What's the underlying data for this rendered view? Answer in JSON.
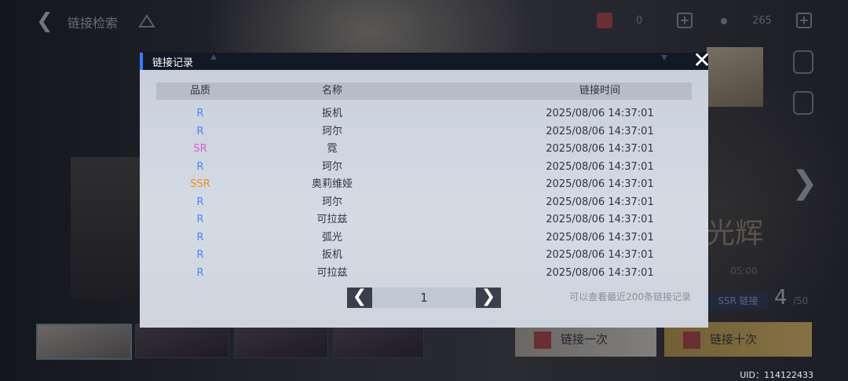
{
  "topbar": {
    "title": "链接检索",
    "resource_1": "0",
    "resource_2": "265"
  },
  "side_labels": [
    "",
    ""
  ],
  "background": {
    "banner_text": "光辉",
    "time_text": "05:00",
    "ssr_label": "SSR 链接",
    "count": "4",
    "count_total": "/50",
    "pull_one": "链接一次",
    "pull_ten": "链接十次",
    "uid": "UID：114122433"
  },
  "modal": {
    "title": "链接记录",
    "headers": {
      "quality": "品质",
      "name": "名称",
      "time": "链接时间"
    },
    "rows": [
      {
        "quality": "R",
        "name": "扳机",
        "time": "2025/08/06 14:37:01"
      },
      {
        "quality": "R",
        "name": "珂尔",
        "time": "2025/08/06 14:37:01"
      },
      {
        "quality": "SR",
        "name": "霓",
        "time": "2025/08/06 14:37:01"
      },
      {
        "quality": "R",
        "name": "珂尔",
        "time": "2025/08/06 14:37:01"
      },
      {
        "quality": "SSR",
        "name": "奥莉维娅",
        "time": "2025/08/06 14:37:01"
      },
      {
        "quality": "R",
        "name": "珂尔",
        "time": "2025/08/06 14:37:01"
      },
      {
        "quality": "R",
        "name": "可拉兹",
        "time": "2025/08/06 14:37:01"
      },
      {
        "quality": "R",
        "name": "弧光",
        "time": "2025/08/06 14:37:01"
      },
      {
        "quality": "R",
        "name": "扳机",
        "time": "2025/08/06 14:37:01"
      },
      {
        "quality": "R",
        "name": "可拉兹",
        "time": "2025/08/06 14:37:01"
      }
    ],
    "page": "1",
    "hint": "可以查看最近200条链接记录"
  },
  "colors": {
    "R": "#4d84f0",
    "SR": "#d35fd8",
    "SSR": "#f0902a",
    "accent": "#3b78ff"
  }
}
